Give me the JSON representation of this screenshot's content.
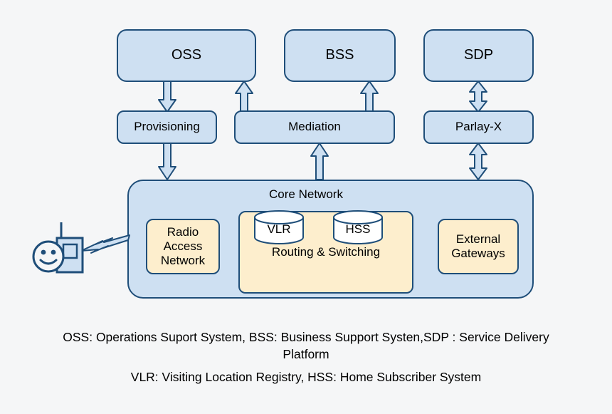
{
  "diagram": {
    "background_color": "#f5f6f7",
    "stroke_color": "#1f4e79",
    "blue_fill": "#cee0f2",
    "yellow_fill": "#fdeecd",
    "white_fill": "#ffffff"
  },
  "top_row": [
    {
      "id": "oss",
      "label": "OSS"
    },
    {
      "id": "bss",
      "label": "BSS"
    },
    {
      "id": "sdp",
      "label": "SDP"
    }
  ],
  "middle_row": [
    {
      "id": "provisioning",
      "label": "Provisioning"
    },
    {
      "id": "mediation",
      "label": "Mediation"
    },
    {
      "id": "parlay-x",
      "label": "Parlay-X"
    }
  ],
  "core": {
    "label": "Core Network",
    "blocks": [
      {
        "id": "ran",
        "label": "Radio\nAccess\nNetwork"
      },
      {
        "id": "routing-switching",
        "label": "Routing & Switching"
      },
      {
        "id": "external-gateways",
        "label": "External\nGateways"
      }
    ],
    "databases": [
      {
        "id": "vlr",
        "label": "VLR"
      },
      {
        "id": "hss",
        "label": "HSS"
      }
    ]
  },
  "connections": [
    {
      "id": "oss-to-provisioning",
      "direction": "down"
    },
    {
      "id": "mediation-to-oss",
      "direction": "up"
    },
    {
      "id": "mediation-to-bss",
      "direction": "up"
    },
    {
      "id": "sdp-to-parlayx",
      "direction": "both"
    },
    {
      "id": "provisioning-to-core",
      "direction": "down"
    },
    {
      "id": "core-to-mediation",
      "direction": "up"
    },
    {
      "id": "parlayx-to-core",
      "direction": "both"
    },
    {
      "id": "handset-to-core",
      "direction": "wireless"
    }
  ],
  "user": {
    "id": "mobile-subscriber",
    "device": "mobile-handset"
  },
  "captions": {
    "line1": "OSS: Operations Suport System, BSS: Business Support Systen,SDP : Service Delivery Platform",
    "line2": "VLR: Visiting Location Registry, HSS: Home Subscriber System"
  }
}
